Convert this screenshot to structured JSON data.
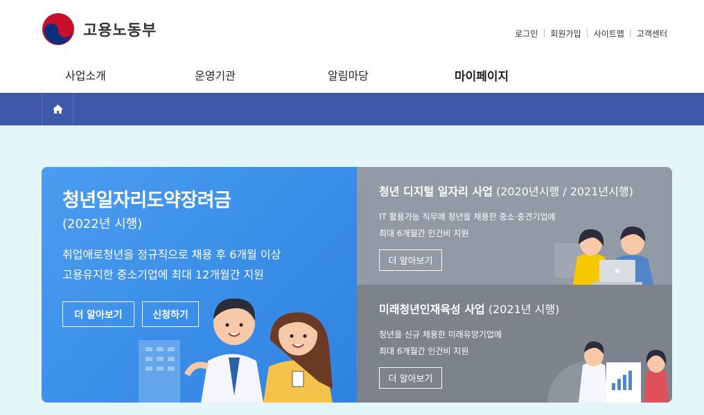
{
  "header": {
    "logo_text": "고용노동부",
    "util_links": [
      "로그인",
      "회원가입",
      "사이트맵",
      "고객센터"
    ]
  },
  "gnb": [
    "사업소개",
    "운영기관",
    "알림마당",
    "마이페이지"
  ],
  "main": {
    "title": "청년일자리도약장려금",
    "subtitle": "(2022년 시행)",
    "desc_line1": "취업애로청년을 정규직으로 채용 후 6개월 이상",
    "desc_line2": "고용유지한 중소기업에 최대 12개월간 지원",
    "btn_more": "더 알아보기",
    "btn_apply": "신청하기"
  },
  "digital": {
    "title": "청년 디지털 일자리 사업",
    "period": " (2020년시행 / 2021년시행)",
    "desc_line1": "IT 활용가능 직무에 청년을 채용한 중소·중견기업에",
    "desc_line2": "최대 6개월간 인건비 지원",
    "btn_more": "더 알아보기"
  },
  "future": {
    "title": "미래청년인재육성 사업",
    "period": " (2021년 시행)",
    "desc_line1": "청년을 신규 채용한 미래유망기업에",
    "desc_line2": "최대 6개월간 인건비 지원",
    "btn_more": "더 알아보기"
  },
  "colors": {
    "nav_bar": "#3f59a8",
    "main_panel": "#3a8fe8",
    "side_top": "#929aa5",
    "side_bottom": "#7c838d",
    "page_bg": "#e4f5f8"
  },
  "icons": {
    "home": "home-icon",
    "logo": "taegeuk-logo-icon"
  }
}
